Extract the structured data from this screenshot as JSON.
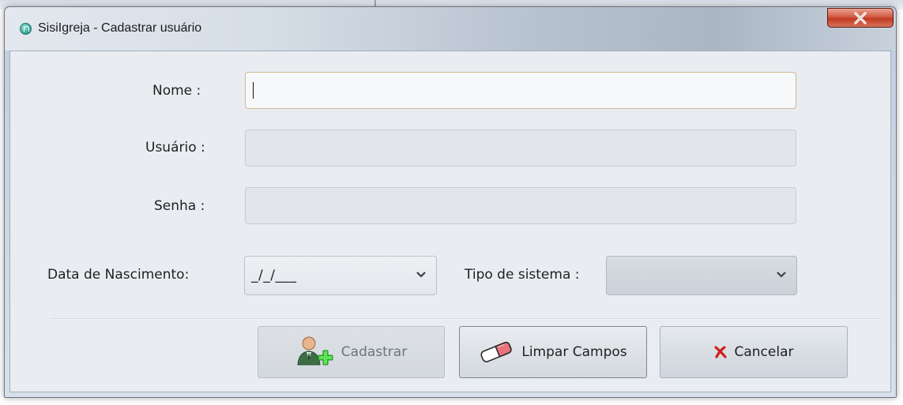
{
  "window": {
    "title": "SisiIgreja - Cadastrar usuário"
  },
  "icons": {
    "app": "church-app-icon",
    "close": "close-icon",
    "register": "add-user-icon",
    "clear": "eraser-icon",
    "cancel": "red-x-icon",
    "dropdown": "chevron-down-icon"
  },
  "form": {
    "nome_label": "Nome :",
    "nome_value": "",
    "usuario_label": "Usuário :",
    "usuario_value": "",
    "senha_label": "Senha :",
    "senha_value": "",
    "nascimento_label": "Data de Nascimento:",
    "nascimento_value": "_/_/___",
    "tipo_label": "Tipo de sistema :",
    "tipo_value": ""
  },
  "buttons": {
    "cadastrar": "Cadastrar",
    "limpar": "Limpar Campos",
    "cancelar": "Cancelar"
  },
  "colors": {
    "close_button": "#c13a22",
    "client_background": "#e9edf2",
    "cancel_icon": "#d0201a"
  }
}
